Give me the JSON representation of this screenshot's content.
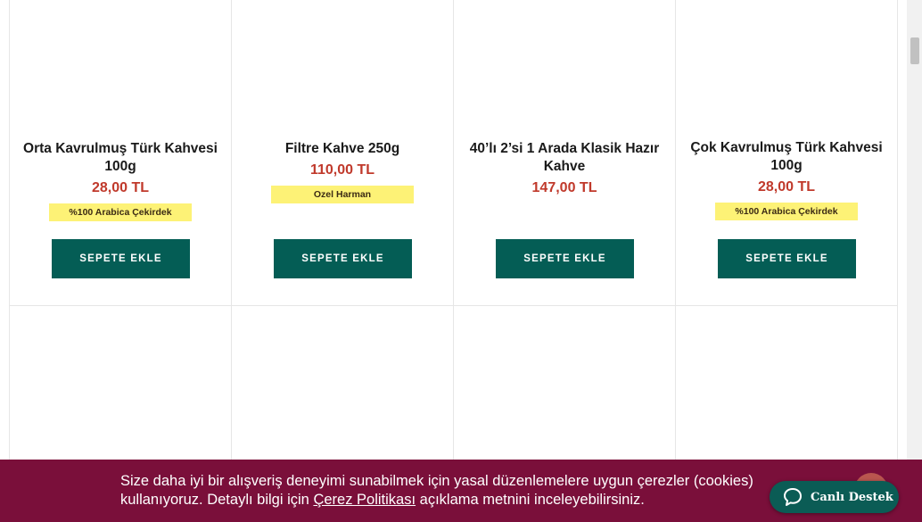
{
  "products": [
    {
      "name": "Orta Kavrulmuş Türk Kahvesi 100g",
      "price": "28,00 TL",
      "badge": "%100 Arabica Çekirdek",
      "button": "SEPETE EKLE"
    },
    {
      "name": "Filtre Kahve 250g",
      "price": "110,00 TL",
      "badge": "Ozel Harman",
      "button": "SEPETE EKLE"
    },
    {
      "name": "40’lı 2’si 1 Arada Klasik Hazır Kahve",
      "price": "147,00 TL",
      "badge": "",
      "button": "SEPETE EKLE"
    },
    {
      "name": "Çok Kavrulmuş Türk Kahvesi 100g",
      "price": "28,00 TL",
      "badge": "%100 Arabica Çekirdek",
      "button": "SEPETE EKLE"
    }
  ],
  "cookie": {
    "text_before": "Size daha iyi bir alışveriş deneyimi sunabilmek için yasal düzenlemelere uygun çerezler (cookies) kullanıyoruz. Detaylı bilgi için ",
    "link": "Çerez Politikası",
    "text_after": " açıklama metnini inceleyebilirsiniz."
  },
  "live_support": {
    "label": "Canlı Destek",
    "icon": "chat-bubble-icon"
  },
  "colors": {
    "accent": "#045d55",
    "price": "#c0392b",
    "badge": "#fdf276",
    "cookie_bg": "#7a0f3a"
  }
}
